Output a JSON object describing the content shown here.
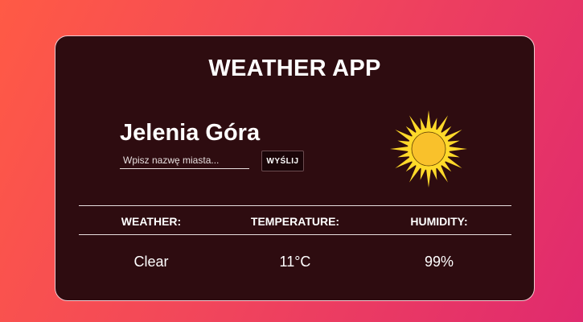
{
  "app": {
    "title": "WEATHER APP"
  },
  "location": {
    "city": "Jelenia Góra"
  },
  "search": {
    "placeholder": "Wpisz nazwę miasta...",
    "value": "",
    "button_label": "WYŚLIJ"
  },
  "weather_icon": {
    "name": "sun-icon",
    "colors": {
      "rays": "#ffd92a",
      "core": "#f9c12b",
      "outline": "#5a3a00"
    }
  },
  "table": {
    "headers": [
      "WEATHER:",
      "TEMPERATURE:",
      "HUMIDITY:"
    ],
    "values": [
      "Clear",
      "11°C",
      "99%"
    ]
  },
  "theme": {
    "card_background": "#2e0c10",
    "gradient": [
      "#ff5a45",
      "#e02a6e"
    ]
  }
}
